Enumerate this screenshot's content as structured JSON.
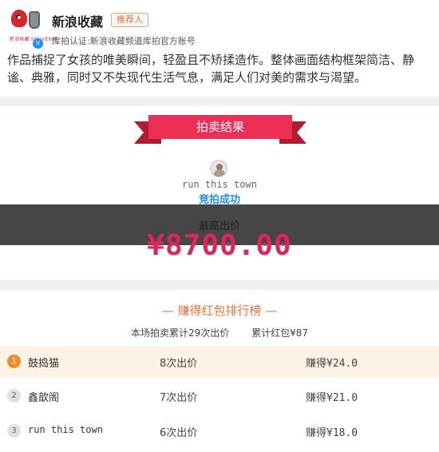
{
  "header": {
    "avatar_logo_text": "新浪收藏 SOUVENIR",
    "name": "新浪收藏",
    "tag": "推荐人",
    "cert": "库拍认证:新浪收藏频道库拍官方账号"
  },
  "description": "作品捕捉了女孩的唯美瞬间，轻盈且不矫揉造作。整体画面结构框架简洁、静谧、典雅，同时又不失现代生活气息，满足人们对美的需求与渴望。",
  "result": {
    "banner": "拍卖结果",
    "winner_name": "run this town",
    "status": "竞拍成功",
    "price_label": "最高出价",
    "price": "¥8700.00"
  },
  "ranking": {
    "title": "— 赚得红包排行榜 —",
    "total_bids": "本场拍卖累计29次出价",
    "total_red": "累计红包¥87",
    "rows": [
      {
        "rank": "1",
        "user": "鼓捣猫",
        "bids": "8次出价",
        "earned": "赚得¥24.0"
      },
      {
        "rank": "2",
        "user": "鑫歆阁",
        "bids": "7次出价",
        "earned": "赚得¥21.0"
      },
      {
        "rank": "3",
        "user": "run this town",
        "bids": "6次出价",
        "earned": "赚得¥18.0"
      }
    ]
  },
  "colors": {
    "accent_red": "#ee2f55",
    "price_red": "#e0245e",
    "link_blue": "#1e90ff",
    "rank_orange": "#e8743b"
  }
}
